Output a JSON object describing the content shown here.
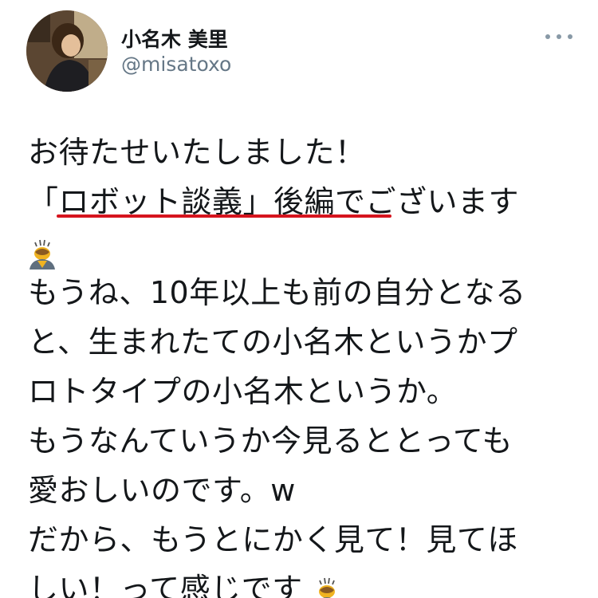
{
  "tweet": {
    "author": {
      "display_name": "小名木 美里",
      "handle": "@misatoxo",
      "avatar_icon": "profile-photo"
    },
    "more_icon": "ellipsis-icon",
    "lines": {
      "l1": "お待たせいたしました！",
      "l2": "「ロボット談義」後編でございます",
      "l4": "もうね、10年以上も前の自分となる",
      "l5": "と、生まれたての小名木というかプ",
      "l6": "ロトタイプの小名木というか。",
      "l7": "もうなんていうか今見るととっても",
      "l8": "愛おしいのです。w",
      "l9": "だから、もうとにかく見て！見てほ",
      "l10": "しい！って感じです"
    },
    "emoji_name": "person-bowing",
    "underline_color": "#d6141e"
  }
}
